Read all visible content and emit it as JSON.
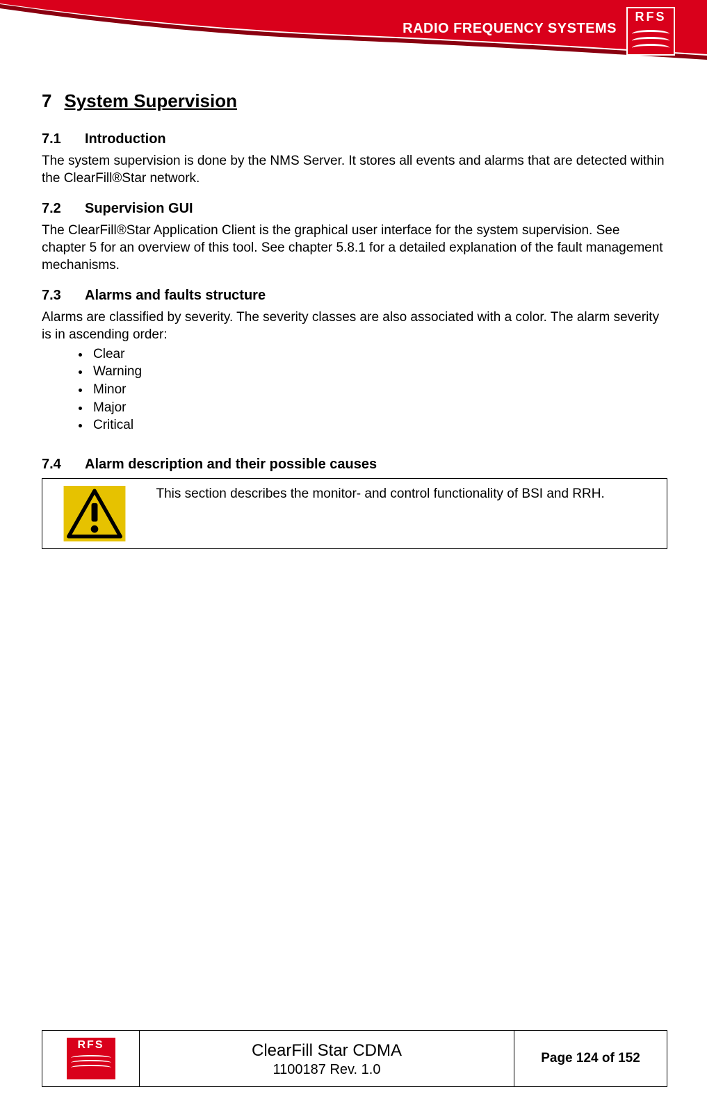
{
  "header": {
    "company_name": "RADIO FREQUENCY SYSTEMS",
    "logo_text": "RFS"
  },
  "h1": {
    "num": "7",
    "title": "System Supervision"
  },
  "sections": [
    {
      "num": "7.1",
      "title": "Introduction",
      "body": "The system supervision is done by the NMS Server. It stores all events and alarms that are detected within the ClearFill®Star network."
    },
    {
      "num": "7.2",
      "title": "Supervision GUI",
      "body": "The ClearFill®Star Application Client is the graphical user interface for the system supervision. See chapter 5 for an overview of this tool. See chapter 5.8.1 for a detailed explanation of the fault management mechanisms."
    },
    {
      "num": "7.3",
      "title": "Alarms and faults structure",
      "body": "Alarms are classified by severity. The severity classes are also associated with a color. The alarm severity is in ascending order:",
      "bullets": [
        "Clear",
        "Warning",
        "Minor",
        "Major",
        "Critical"
      ]
    },
    {
      "num": "7.4",
      "title": "Alarm description and their possible causes",
      "note": "This section describes the monitor- and control functionality of BSI and RRH."
    }
  ],
  "footer": {
    "logo_text": "RFS",
    "title": "ClearFill Star CDMA",
    "subtitle": "1100187 Rev. 1.0",
    "page": "Page 124 of 152"
  }
}
